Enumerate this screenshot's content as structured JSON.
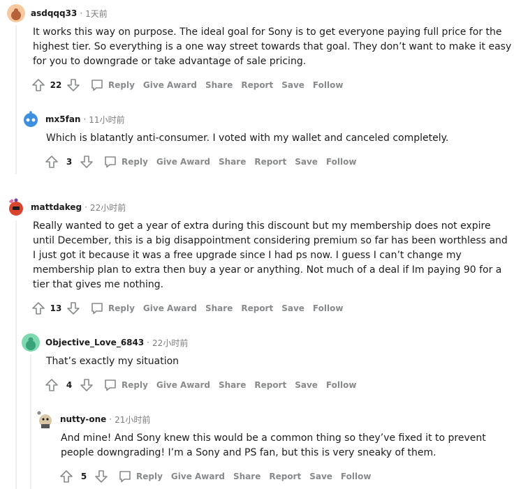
{
  "comments": [
    {
      "username": "asdqqq33",
      "time": "1天前",
      "text": "It works this way on purpose. The ideal goal for Sony is to get everyone paying full price for the\nhighest tier. So everything is a one way street towards that goal. They don’t want to make it easy\nfor you to downgrade or take advantage of sale pricing.",
      "votes": "22"
    },
    {
      "username": "mx5fan",
      "time": "11小时前",
      "text": "Which is blatantly anti-consumer. I voted with my wallet and canceled completely.",
      "votes": "3"
    },
    {
      "username": "mattdakeg",
      "time": "22小时前",
      "text": "Really wanted to get a year of extra during this discount but my membership does not expire\nuntil December, this is a big disappointment considering premium so far has been worthless and\nI just got it because it was a free upgrade since I had ps now. I guess I can’t change my\nmembership plan to extra then buy a year or anything. Not much of a deal if Im paying 90 for a\ntier that gives me nothing.",
      "votes": "13"
    },
    {
      "username": "Objective_Love_6843",
      "time": "22小时前",
      "text": "That’s exactly my situation",
      "votes": "4"
    },
    {
      "username": "nutty-one",
      "time": "21小时前",
      "text": "And mine! And Sony knew this would be a common thing so they’ve fixed it to prevent\npeople downgrading! I’m a Sony and PS fan, but this is very sneaky of them.",
      "votes": "5"
    }
  ],
  "actions": {
    "reply": "Reply",
    "give_award": "Give Award",
    "share": "Share",
    "report": "Report",
    "save": "Save",
    "follow": "Follow"
  },
  "separator": "·",
  "icons": [
    "upvote-icon",
    "downvote-icon",
    "reply-icon"
  ],
  "colors": {
    "text": "#1c1c1c",
    "meta": "#7c7c7c",
    "action": "#878a8c",
    "thread": "#edeff1"
  }
}
